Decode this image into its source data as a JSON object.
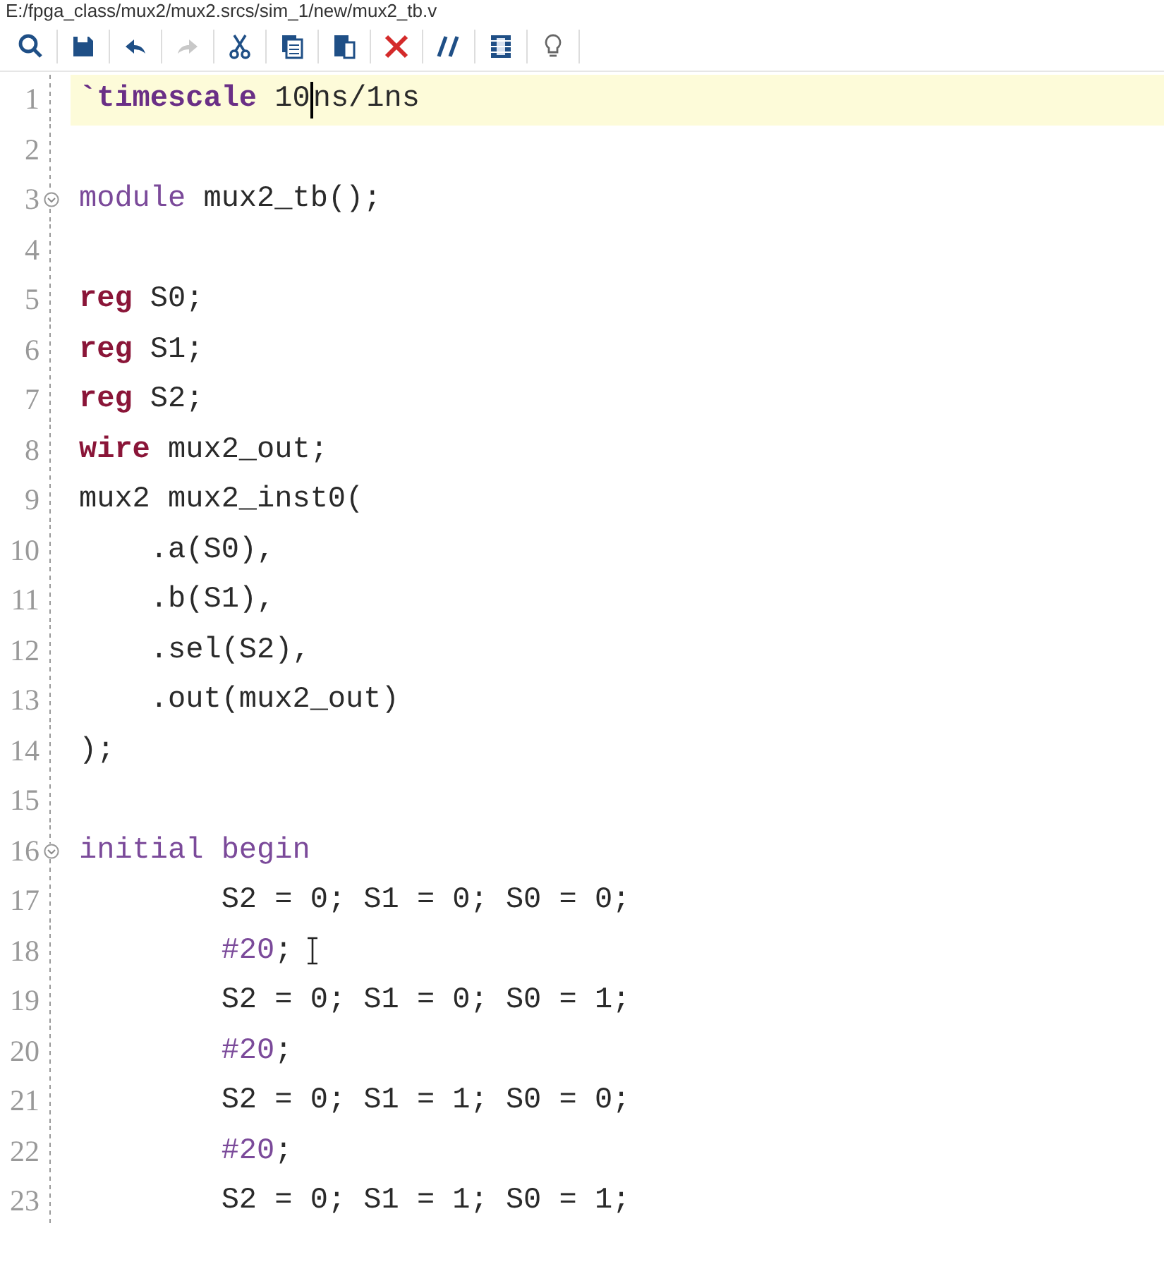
{
  "path": "E:/fpga_class/mux2/mux2.srcs/sim_1/new/mux2_tb.v",
  "toolbar": [
    {
      "kind": "search"
    },
    {
      "kind": "save"
    },
    {
      "kind": "undo"
    },
    {
      "kind": "redo",
      "disabled": true
    },
    {
      "kind": "cut"
    },
    {
      "kind": "copy"
    },
    {
      "kind": "paste"
    },
    {
      "kind": "delete"
    },
    {
      "kind": "comment"
    },
    {
      "kind": "columns"
    },
    {
      "kind": "hint"
    }
  ],
  "lines": [
    {
      "number": "1",
      "current": true,
      "tokens": [
        {
          "kind": "directive",
          "text": "`timescale"
        },
        {
          "kind": "plain",
          "text": " 10"
        },
        {
          "kind": "caret"
        },
        {
          "kind": "plain",
          "text": "ns/1ns"
        }
      ]
    },
    {
      "number": "2"
    },
    {
      "number": "3",
      "fold": true,
      "tokens": [
        {
          "kind": "keyword",
          "text": "module"
        },
        {
          "kind": "plain",
          "text": " mux2_tb();"
        }
      ]
    },
    {
      "number": "4"
    },
    {
      "number": "5",
      "tokens": [
        {
          "kind": "type",
          "text": "reg"
        },
        {
          "kind": "plain",
          "text": " S0;"
        }
      ]
    },
    {
      "number": "6",
      "tokens": [
        {
          "kind": "type",
          "text": "reg"
        },
        {
          "kind": "plain",
          "text": " S1;"
        }
      ]
    },
    {
      "number": "7",
      "tokens": [
        {
          "kind": "type",
          "text": "reg"
        },
        {
          "kind": "plain",
          "text": " S2;"
        }
      ]
    },
    {
      "number": "8",
      "tokens": [
        {
          "kind": "type",
          "text": "wire"
        },
        {
          "kind": "plain",
          "text": " mux2_out;"
        }
      ]
    },
    {
      "number": "9",
      "tokens": [
        {
          "kind": "plain",
          "text": "mux2 mux2_inst0("
        }
      ]
    },
    {
      "number": "10",
      "tokens": [
        {
          "kind": "plain",
          "text": "    .a(S0),"
        }
      ]
    },
    {
      "number": "11",
      "tokens": [
        {
          "kind": "plain",
          "text": "    .b(S1),"
        }
      ]
    },
    {
      "number": "12",
      "tokens": [
        {
          "kind": "plain",
          "text": "    .sel(S2),"
        }
      ]
    },
    {
      "number": "13",
      "tokens": [
        {
          "kind": "plain",
          "text": "    .out(mux2_out)"
        }
      ]
    },
    {
      "number": "14",
      "tokens": [
        {
          "kind": "plain",
          "text": ");"
        }
      ]
    },
    {
      "number": "15"
    },
    {
      "number": "16",
      "fold": true,
      "tokens": [
        {
          "kind": "keyword",
          "text": "initial begin"
        }
      ]
    },
    {
      "number": "17",
      "tokens": [
        {
          "kind": "plain",
          "text": "        S2 = 0; S1 = 0; S0 = 0;"
        }
      ]
    },
    {
      "number": "18",
      "tokens": [
        {
          "kind": "keyword",
          "text": "        #20"
        },
        {
          "kind": "plain",
          "text": ";"
        },
        {
          "kind": "pointer"
        }
      ]
    },
    {
      "number": "19",
      "tokens": [
        {
          "kind": "plain",
          "text": "        S2 = 0; S1 = 0; S0 = 1;"
        }
      ]
    },
    {
      "number": "20",
      "tokens": [
        {
          "kind": "keyword",
          "text": "        #20"
        },
        {
          "kind": "plain",
          "text": ";"
        }
      ]
    },
    {
      "number": "21",
      "tokens": [
        {
          "kind": "plain",
          "text": "        S2 = 0; S1 = 1; S0 = 0;"
        }
      ]
    },
    {
      "number": "22",
      "tokens": [
        {
          "kind": "keyword",
          "text": "        #20"
        },
        {
          "kind": "plain",
          "text": ";"
        }
      ]
    },
    {
      "number": "23",
      "tokens": [
        {
          "kind": "plain",
          "text": "        S2 = 0; S1 = 1; S0 = 1;"
        }
      ]
    }
  ]
}
